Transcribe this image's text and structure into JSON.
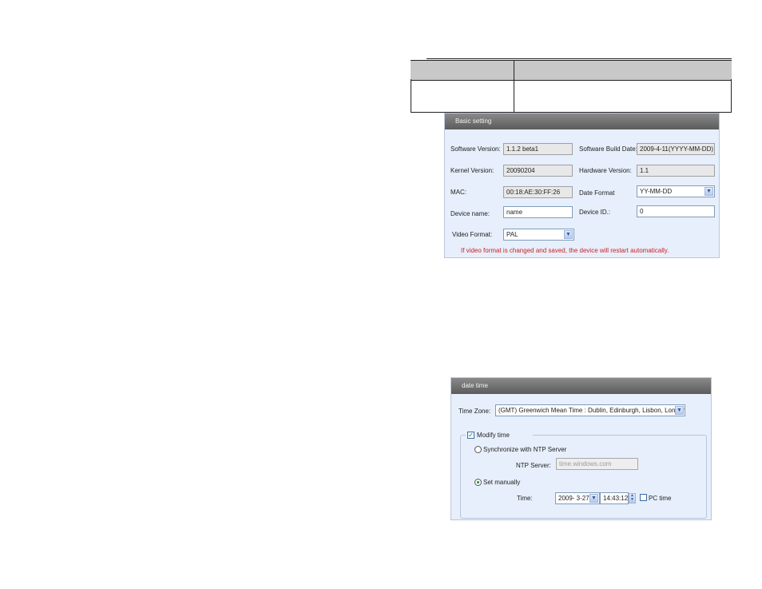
{
  "basic": {
    "title": "Basic setting",
    "software_version_label": "Software Version:",
    "software_version": "1.1.2 beta1",
    "build_date_label": "Software Build Date:",
    "build_date": "2009-4-11(YYYY-MM-DD)",
    "kernel_version_label": "Kernel Version:",
    "kernel_version": "20090204",
    "hardware_version_label": "Hardware Version:",
    "hardware_version": "1.1",
    "mac_label": "MAC:",
    "mac": "00:18:AE:30:FF:26",
    "date_format_label": "Date Format",
    "date_format": "YY-MM-DD",
    "device_name_label": "Device name:",
    "device_name": "name",
    "device_id_label": "Device ID.:",
    "device_id": "0",
    "video_format_label": "Video Format:",
    "video_format": "PAL",
    "warning": "If video format is changed and saved, the device will restart automatically."
  },
  "datetime": {
    "title": "date time",
    "time_zone_label": "Time Zone:",
    "time_zone": "(GMT) Greenwich Mean Time : Dublin, Edinburgh, Lisbon, London",
    "modify_time_label": "Modify time",
    "ntp_label": "Synchronize with NTP Server",
    "ntp_server_label": "NTP Server:",
    "ntp_server": "time.windows.com",
    "set_manually_label": "Set manually",
    "time_label": "Time:",
    "date_value": "2009- 3-27",
    "time_value": "14:43:12",
    "pc_time_label": "PC time"
  },
  "icons": {
    "dropdown": "chevron-down-icon",
    "spin": "up-down-arrows-icon",
    "check": "checkmark-icon"
  },
  "colors": {
    "panel_bg": "#e6effb",
    "title_bar": "#6e6e6e",
    "warning": "#cc2222"
  }
}
